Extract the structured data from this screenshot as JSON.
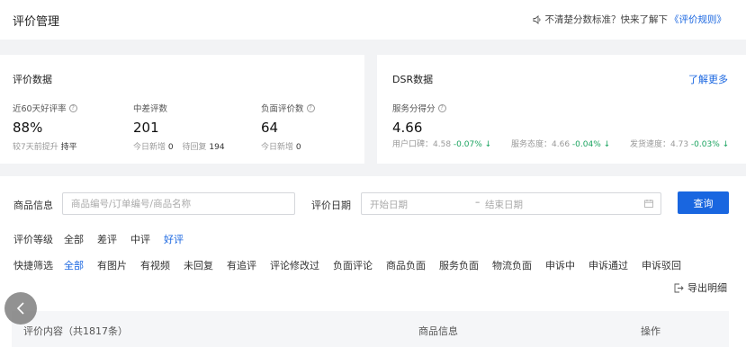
{
  "header": {
    "title": "评价管理",
    "notice_text": "不清楚分数标准？快来了解下",
    "notice_link": "《评价规则》"
  },
  "eval_data": {
    "title": "评价数据",
    "metrics": [
      {
        "label": "近60天好评率",
        "value": "88%",
        "sub_label": "较7天前提升",
        "sub_value": "持平"
      },
      {
        "label": "中差评数",
        "value": "201",
        "sub_label": "今日新增",
        "sub_value": "0",
        "sub_label2": "待回复",
        "sub_value2": "194"
      },
      {
        "label": "负面评价数",
        "value": "64",
        "sub_label": "今日新增",
        "sub_value": "0"
      }
    ]
  },
  "dsr": {
    "title": "DSR数据",
    "learn_more": "了解更多",
    "score_label": "服务分得分",
    "score_value": "4.66",
    "items": [
      {
        "label": "用户口碑：4.58",
        "delta": "-0.07%"
      },
      {
        "label": "服务态度：4.66",
        "delta": "-0.04%"
      },
      {
        "label": "发货速度：4.73",
        "delta": "-0.03%"
      }
    ]
  },
  "search": {
    "product_label": "商品信息",
    "product_placeholder": "商品编号/订单编号/商品名称",
    "date_label": "评价日期",
    "date_start_placeholder": "开始日期",
    "date_separator": "–",
    "date_end_placeholder": "结束日期",
    "query_button": "查询"
  },
  "rating_filter": {
    "label": "评价等级",
    "options": [
      "全部",
      "差评",
      "中评",
      "好评"
    ],
    "active_index": 3
  },
  "quick_filter": {
    "label": "快捷筛选",
    "options": [
      "全部",
      "有图片",
      "有视频",
      "未回复",
      "有追评",
      "评论修改过",
      "负面评论",
      "商品负面",
      "服务负面",
      "物流负面",
      "申诉中",
      "申诉通过",
      "申诉驳回"
    ],
    "active_index": 0
  },
  "export_label": "导出明细",
  "table": {
    "headers": [
      "评价内容（共1817条）",
      "商品信息",
      "操作"
    ]
  },
  "colors": {
    "accent": "#1966e0",
    "up_arrow": "#1aa35f",
    "background": "#f2f3f5"
  }
}
